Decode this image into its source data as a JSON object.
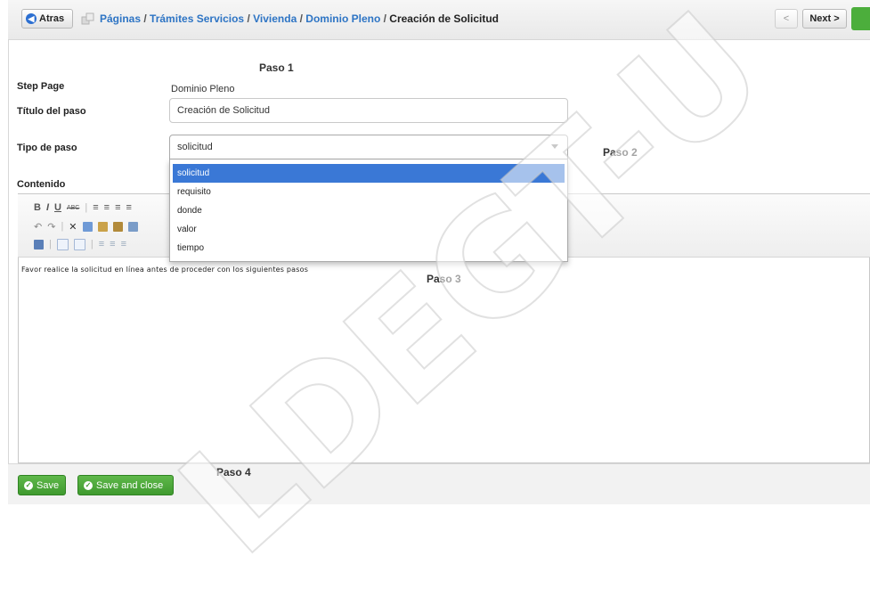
{
  "header": {
    "back_label": "Atras",
    "breadcrumb": [
      "Páginas",
      "Trámites Servicios",
      "Vivienda",
      "Dominio Pleno"
    ],
    "current": "Creación de Solicitud",
    "prev_label": "<",
    "next_label": "Next >"
  },
  "form": {
    "step_page_label": "Step Page",
    "step_page_value": "Dominio Pleno",
    "title_label": "Título del paso",
    "title_value": "Creación de Solicitud",
    "type_label": "Tipo de paso",
    "type_value": "solicitud",
    "type_options": [
      "solicitud",
      "requisito",
      "donde",
      "valor",
      "tiempo"
    ],
    "content_label": "Contenido",
    "content_text": "Favor realice la solicitud en línea antes de proceder con los siguientes pasos"
  },
  "annotations": {
    "paso1": "Paso 1",
    "paso2": "Paso 2",
    "paso3": "Paso 3",
    "paso4": "Paso 4"
  },
  "footer": {
    "save_label": "Save",
    "save_close_label": "Save and close"
  },
  "watermark": "LDEGT-U",
  "colors": {
    "link_blue": "#2d74c4",
    "selected_blue": "#3a78d6",
    "button_green": "#4cae3c"
  }
}
